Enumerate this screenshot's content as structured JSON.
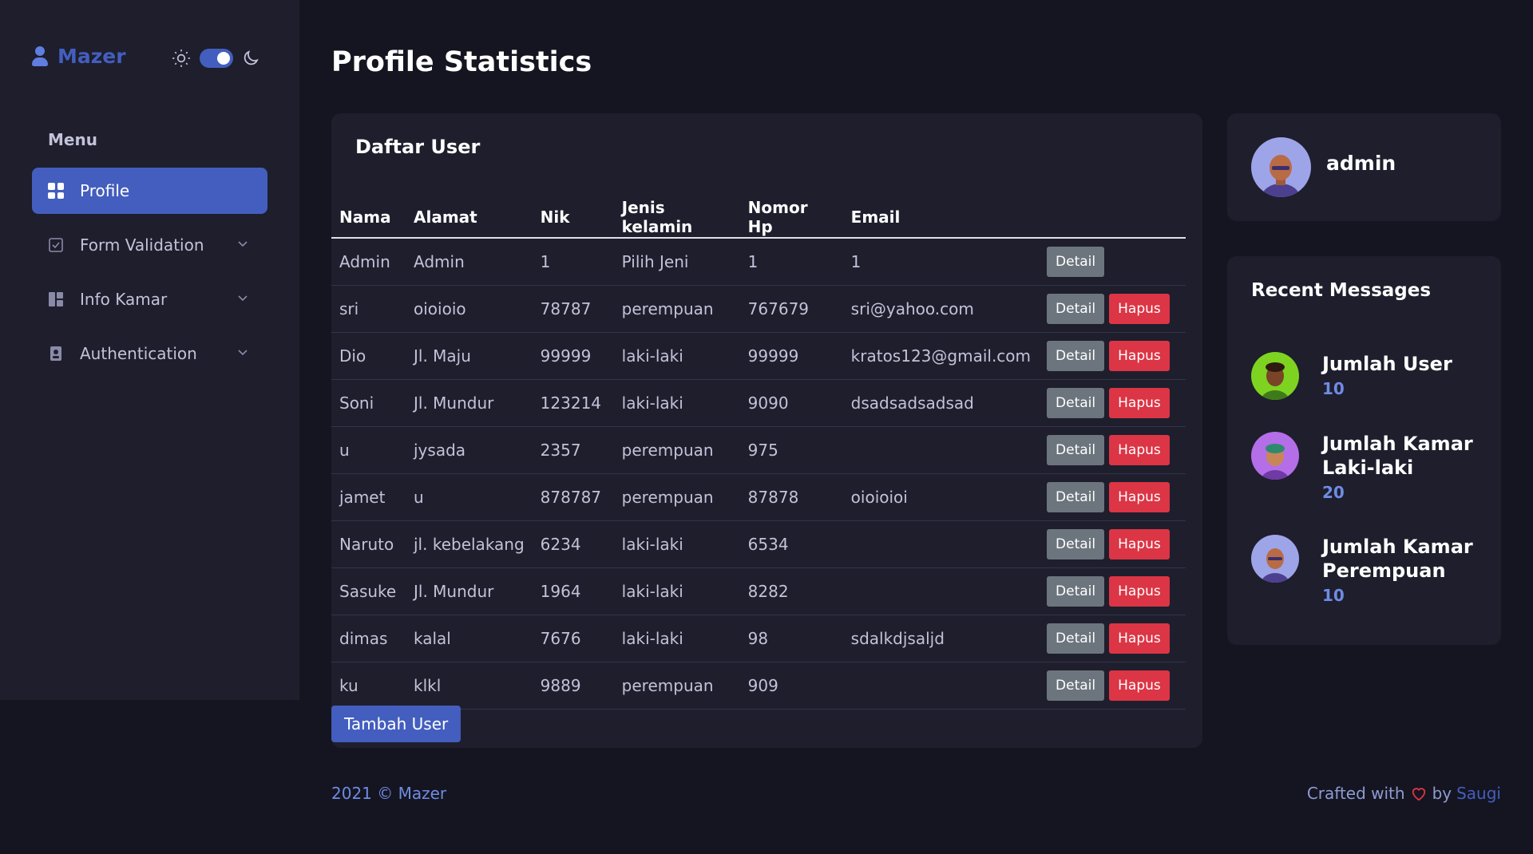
{
  "brand": {
    "name": "Mazer"
  },
  "sidebar": {
    "menu_title": "Menu",
    "items": [
      {
        "label": "Profile",
        "icon": "grid-icon",
        "active": true
      },
      {
        "label": "Form Validation",
        "icon": "checkbox-icon"
      },
      {
        "label": "Info Kamar",
        "icon": "layout-icon"
      },
      {
        "label": "Authentication",
        "icon": "person-badge-icon"
      }
    ]
  },
  "page": {
    "title": "Profile Statistics"
  },
  "users_card": {
    "title": "Daftar User",
    "columns": [
      "Nama",
      "Alamat",
      "Nik",
      "Jenis kelamin",
      "Nomor Hp",
      "Email"
    ],
    "rows": [
      {
        "nama": "Admin",
        "alamat": "Admin",
        "nik": "1",
        "jk": "Pilih Jeni",
        "hp": "1",
        "email": "1",
        "hapus": false
      },
      {
        "nama": "sri",
        "alamat": "oioioio",
        "nik": "78787",
        "jk": "perempuan",
        "hp": "767679",
        "email": "sri@yahoo.com",
        "hapus": true
      },
      {
        "nama": "Dio",
        "alamat": "Jl. Maju",
        "nik": "99999",
        "jk": "laki-laki",
        "hp": "99999",
        "email": "kratos123@gmail.com",
        "hapus": true
      },
      {
        "nama": "Soni",
        "alamat": "Jl. Mundur",
        "nik": "123214",
        "jk": "laki-laki",
        "hp": "9090",
        "email": "dsadsadsadsad",
        "hapus": true
      },
      {
        "nama": "u",
        "alamat": "jysada",
        "nik": "2357",
        "jk": "perempuan",
        "hp": "975",
        "email": "",
        "hapus": true
      },
      {
        "nama": "jamet",
        "alamat": "u",
        "nik": "878787",
        "jk": "perempuan",
        "hp": "87878",
        "email": "oioioioi",
        "hapus": true
      },
      {
        "nama": "Naruto",
        "alamat": "jl. kebelakang",
        "nik": "6234",
        "jk": "laki-laki",
        "hp": "6534",
        "email": "",
        "hapus": true
      },
      {
        "nama": "Sasuke",
        "alamat": "Jl. Mundur",
        "nik": "1964",
        "jk": "laki-laki",
        "hp": "8282",
        "email": "",
        "hapus": true
      },
      {
        "nama": "dimas",
        "alamat": "kalal",
        "nik": "7676",
        "jk": "laki-laki",
        "hp": "98",
        "email": "sdalkdjsaljd",
        "hapus": true
      },
      {
        "nama": "ku",
        "alamat": "klkl",
        "nik": "9889",
        "jk": "perempuan",
        "hp": "909",
        "email": "",
        "hapus": true
      }
    ],
    "detail_label": "Detail",
    "hapus_label": "Hapus",
    "add_label": "Tambah User"
  },
  "profile": {
    "name": "admin"
  },
  "messages": {
    "title": "Recent Messages",
    "items": [
      {
        "label": "Jumlah User",
        "value": "10",
        "avatar_color": "#7ed321"
      },
      {
        "label": "Jumlah Kamar Laki-laki",
        "value": "20",
        "avatar_color": "#b46ee8"
      },
      {
        "label": "Jumlah Kamar Perempuan",
        "value": "10",
        "avatar_color": "#8e8fe0"
      }
    ]
  },
  "footer": {
    "copyright": "2021 © Mazer",
    "crafted": "Crafted with",
    "by": "by",
    "author": "Saugi"
  },
  "colors": {
    "accent": "#435ebe",
    "danger": "#dc3545",
    "secondary": "#6c757d"
  }
}
